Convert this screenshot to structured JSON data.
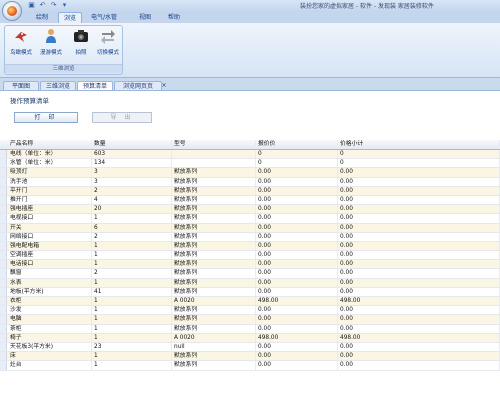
{
  "window": {
    "title": "装扮您家的虚拟家居 - 软件 - 发现装 家居装修软件"
  },
  "menu_tabs": [
    {
      "label": "绘制"
    },
    {
      "label": "浏览"
    },
    {
      "label": "电气/水管"
    },
    {
      "label": "视图"
    },
    {
      "label": "帮助"
    }
  ],
  "ribbon": {
    "group_label": "三维浏览",
    "buttons": [
      {
        "label": "鸟瞰模式"
      },
      {
        "label": "漫游模式"
      },
      {
        "label": "拍照"
      },
      {
        "label": "切换模式"
      }
    ]
  },
  "doc_tabs": [
    {
      "label": "平面图"
    },
    {
      "label": "三维浏览"
    },
    {
      "label": "预算清单"
    },
    {
      "label": "浏览网页页"
    }
  ],
  "doc_tab_close": "×",
  "panel": {
    "title": "操作预算清单",
    "print_label": "打 印",
    "export_label": "导 出"
  },
  "table": {
    "headers": [
      "产品名称",
      "数量",
      "型号",
      "报价价",
      "价格小计"
    ],
    "rows": [
      [
        "电线（单位：米）",
        "603",
        "",
        "0",
        "0"
      ],
      [
        "水管（单位：米）",
        "134",
        "",
        "0",
        "0"
      ],
      [
        "吸顶灯",
        "3",
        "默放系列",
        "0.00",
        "0.00"
      ],
      [
        "洗手池",
        "3",
        "默放系列",
        "0.00",
        "0.00"
      ],
      [
        "平开门",
        "2",
        "默放系列",
        "0.00",
        "0.00"
      ],
      [
        "推开门",
        "4",
        "默放系列",
        "0.00",
        "0.00"
      ],
      [
        "强电插座",
        "20",
        "默放系列",
        "0.00",
        "0.00"
      ],
      [
        "电视接口",
        "1",
        "默放系列",
        "0.00",
        "0.00"
      ],
      [
        "开关",
        "6",
        "默放系列",
        "0.00",
        "0.00"
      ],
      [
        "网络接口",
        "2",
        "默放系列",
        "0.00",
        "0.00"
      ],
      [
        "强电配电箱",
        "1",
        "默放系列",
        "0.00",
        "0.00"
      ],
      [
        "空调插座",
        "1",
        "默放系列",
        "0.00",
        "0.00"
      ],
      [
        "电话接口",
        "1",
        "默放系列",
        "0.00",
        "0.00"
      ],
      [
        "飘窗",
        "2",
        "默放系列",
        "0.00",
        "0.00"
      ],
      [
        "水表",
        "1",
        "默放系列",
        "0.00",
        "0.00"
      ],
      [
        "地板(平方米)",
        "41",
        "默放系列",
        "0.00",
        "0.00"
      ],
      [
        "衣柜",
        "1",
        "A 0020",
        "498.00",
        "498.00"
      ],
      [
        "沙发",
        "1",
        "默放系列",
        "0.00",
        "0.00"
      ],
      [
        "电脑",
        "1",
        "默放系列",
        "0.00",
        "0.00"
      ],
      [
        "茶柜",
        "1",
        "默放系列",
        "0.00",
        "0.00"
      ],
      [
        "椅子",
        "1",
        "A 0020",
        "498.00",
        "498.00"
      ],
      [
        "天花板3(平方米)",
        "23",
        "null",
        "0.00",
        "0.00"
      ],
      [
        "床",
        "1",
        "默放系列",
        "0.00",
        "0.00"
      ],
      [
        "灶台",
        "1",
        "默放系列",
        "0.00",
        "0.00"
      ]
    ]
  }
}
